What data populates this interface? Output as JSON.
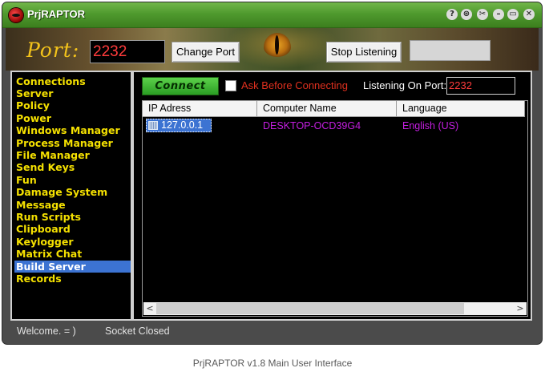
{
  "window": {
    "title": "PrjRAPTOR",
    "title_buttons": [
      "?",
      "⊛",
      "✂",
      "–",
      "▭",
      "✕"
    ]
  },
  "header": {
    "port_label": "Port:",
    "port_value": "2232",
    "change_port_button": "Change Port",
    "stop_listening_button": "Stop Listening"
  },
  "sidebar": {
    "items": [
      {
        "label": "Connections"
      },
      {
        "label": "Server"
      },
      {
        "label": "Policy"
      },
      {
        "label": "Power"
      },
      {
        "label": "Windows Manager"
      },
      {
        "label": "Process Manager"
      },
      {
        "label": "File Manager"
      },
      {
        "label": "Send Keys"
      },
      {
        "label": "Fun"
      },
      {
        "label": "Damage System"
      },
      {
        "label": "Message"
      },
      {
        "label": "Run Scripts"
      },
      {
        "label": "Clipboard"
      },
      {
        "label": "Keylogger"
      },
      {
        "label": "Matrix Chat"
      },
      {
        "label": "Build Server",
        "selected": true
      },
      {
        "label": "Records"
      }
    ]
  },
  "main": {
    "connect_button": "Connect",
    "ask_before_connecting": "Ask Before Connecting",
    "ask_checked": false,
    "listening_label": "Listening On Port:",
    "listening_port": "2232",
    "columns": [
      "IP Adress",
      "Computer Name",
      "Language"
    ],
    "rows": [
      {
        "ip": "127.0.0.1",
        "computer_name": "DESKTOP-OCD39G4",
        "language": "English (US)"
      }
    ]
  },
  "statusbar": {
    "welcome": "Welcome.  = )",
    "socket": "Socket Closed"
  },
  "caption": "PrjRAPTOR v1.8 Main User Interface",
  "colors": {
    "titlebar": "#4f9a2e",
    "sidebar_text": "#f4e000",
    "selection": "#3c73d2",
    "port_text": "#ff3b3b",
    "computer_name": "#c41ee0",
    "language": "#c41ee0"
  }
}
